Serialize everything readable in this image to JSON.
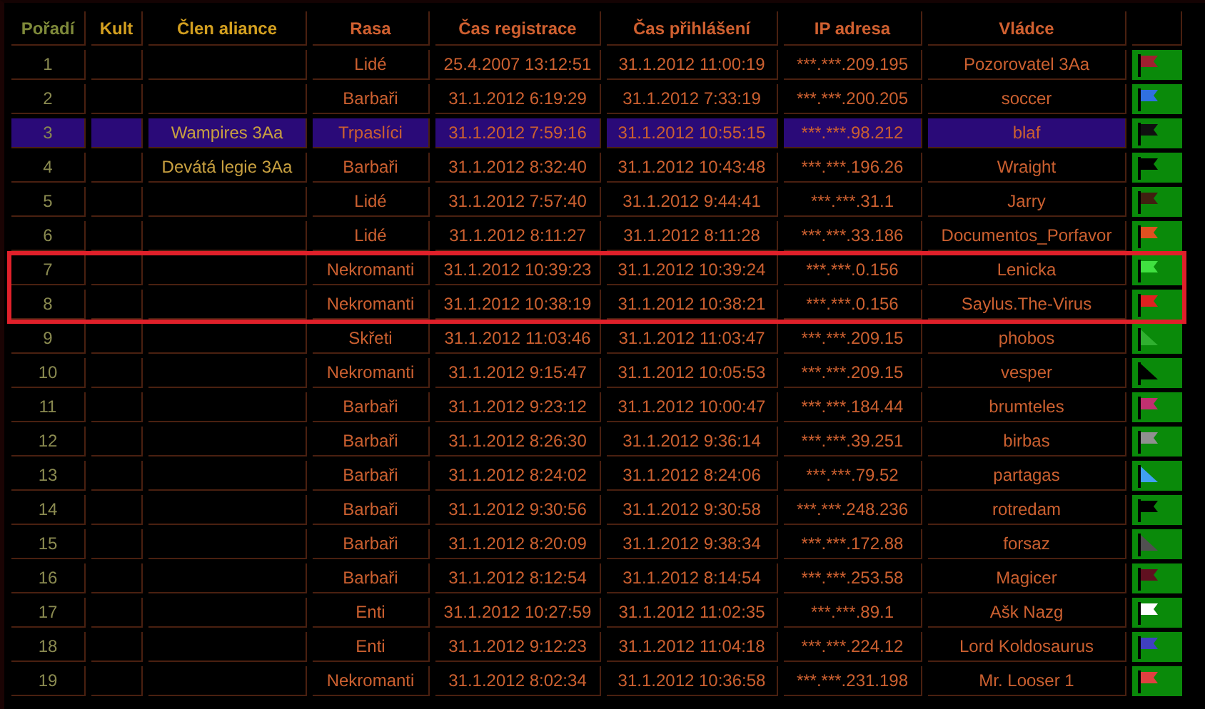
{
  "table": {
    "columns": [
      "Pořadí",
      "Kult",
      "Člen aliance",
      "Rasa",
      "Čas registrace",
      "Čas přihlášení",
      "IP adresa",
      "Vládce"
    ],
    "rows": [
      {
        "rank": "1",
        "alliance": "",
        "race": "Lidé",
        "registered": "25.4.2007 13:12:51",
        "login": "31.1.2012 11:00:19",
        "ip": "***.***.209.195",
        "ruler": "Pozorovatel 3Aa",
        "flag": {
          "kind": "banner",
          "color": "#a02030"
        },
        "selected": false,
        "marked": false
      },
      {
        "rank": "2",
        "alliance": "",
        "race": "Barbaři",
        "registered": "31.1.2012 6:19:29",
        "login": "31.1.2012 7:33:19",
        "ip": "***.***.200.205",
        "ruler": "soccer",
        "flag": {
          "kind": "banner",
          "color": "#3070e0"
        },
        "selected": false,
        "marked": false
      },
      {
        "rank": "3",
        "alliance": "Wampires 3Aa",
        "race": "Trpaslíci",
        "registered": "31.1.2012 7:59:16",
        "login": "31.1.2012 10:55:15",
        "ip": "***.***.98.212",
        "ruler": "blaf",
        "flag": {
          "kind": "banner",
          "color": "#101010"
        },
        "selected": true,
        "marked": false
      },
      {
        "rank": "4",
        "alliance": "Devátá legie 3Aa",
        "race": "Barbaři",
        "registered": "31.1.2012 8:32:40",
        "login": "31.1.2012 10:43:48",
        "ip": "***.***.196.26",
        "ruler": "Wraight",
        "flag": {
          "kind": "banner",
          "color": "#000000"
        },
        "selected": false,
        "marked": false
      },
      {
        "rank": "5",
        "alliance": "",
        "race": "Lidé",
        "registered": "31.1.2012 7:57:40",
        "login": "31.1.2012 9:44:41",
        "ip": "***.***.31.1",
        "ruler": "Jarry",
        "flag": {
          "kind": "banner",
          "color": "#402010"
        },
        "selected": false,
        "marked": false
      },
      {
        "rank": "6",
        "alliance": "",
        "race": "Lidé",
        "registered": "31.1.2012 8:11:27",
        "login": "31.1.2012 8:11:28",
        "ip": "***.***.33.186",
        "ruler": "Documentos_Porfavor",
        "flag": {
          "kind": "banner",
          "color": "#e05020"
        },
        "selected": false,
        "marked": false
      },
      {
        "rank": "7",
        "alliance": "",
        "race": "Nekromanti",
        "registered": "31.1.2012 10:39:23",
        "login": "31.1.2012 10:39:24",
        "ip": "***.***.0.156",
        "ruler": "Lenicka",
        "flag": {
          "kind": "banner",
          "color": "#40e040"
        },
        "selected": false,
        "marked": true
      },
      {
        "rank": "8",
        "alliance": "",
        "race": "Nekromanti",
        "registered": "31.1.2012 10:38:19",
        "login": "31.1.2012 10:38:21",
        "ip": "***.***.0.156",
        "ruler": "Saylus.The-Virus",
        "flag": {
          "kind": "banner",
          "color": "#e02020"
        },
        "selected": false,
        "marked": true
      },
      {
        "rank": "9",
        "alliance": "",
        "race": "Skřeti",
        "registered": "31.1.2012 11:03:46",
        "login": "31.1.2012 11:03:47",
        "ip": "***.***.209.15",
        "ruler": "phobos",
        "flag": {
          "kind": "pennant",
          "color": "#30b030"
        },
        "selected": false,
        "marked": false
      },
      {
        "rank": "10",
        "alliance": "",
        "race": "Nekromanti",
        "registered": "31.1.2012 9:15:47",
        "login": "31.1.2012 10:05:53",
        "ip": "***.***.209.15",
        "ruler": "vesper",
        "flag": {
          "kind": "pennant",
          "color": "#000000"
        },
        "selected": false,
        "marked": false
      },
      {
        "rank": "11",
        "alliance": "",
        "race": "Barbaři",
        "registered": "31.1.2012 9:23:12",
        "login": "31.1.2012 10:00:47",
        "ip": "***.***.184.44",
        "ruler": "brumteles",
        "flag": {
          "kind": "banner",
          "color": "#c03070"
        },
        "selected": false,
        "marked": false
      },
      {
        "rank": "12",
        "alliance": "",
        "race": "Barbaři",
        "registered": "31.1.2012 8:26:30",
        "login": "31.1.2012 9:36:14",
        "ip": "***.***.39.251",
        "ruler": "birbas",
        "flag": {
          "kind": "banner",
          "color": "#909090"
        },
        "selected": false,
        "marked": false
      },
      {
        "rank": "13",
        "alliance": "",
        "race": "Barbaři",
        "registered": "31.1.2012 8:24:02",
        "login": "31.1.2012 8:24:06",
        "ip": "***.***.79.52",
        "ruler": "partagas",
        "flag": {
          "kind": "pennant",
          "color": "#40a0f0"
        },
        "selected": false,
        "marked": false
      },
      {
        "rank": "14",
        "alliance": "",
        "race": "Barbaři",
        "registered": "31.1.2012 9:30:56",
        "login": "31.1.2012 9:30:58",
        "ip": "***.***.248.236",
        "ruler": "rotredam",
        "flag": {
          "kind": "banner",
          "color": "#000000"
        },
        "selected": false,
        "marked": false
      },
      {
        "rank": "15",
        "alliance": "",
        "race": "Barbaři",
        "registered": "31.1.2012 8:20:09",
        "login": "31.1.2012 9:38:34",
        "ip": "***.***.172.88",
        "ruler": "forsaz",
        "flag": {
          "kind": "pennant",
          "color": "#505050"
        },
        "selected": false,
        "marked": false
      },
      {
        "rank": "16",
        "alliance": "",
        "race": "Barbaři",
        "registered": "31.1.2012 8:12:54",
        "login": "31.1.2012 8:14:54",
        "ip": "***.***.253.58",
        "ruler": "Magicer",
        "flag": {
          "kind": "banner",
          "color": "#601020"
        },
        "selected": false,
        "marked": false
      },
      {
        "rank": "17",
        "alliance": "",
        "race": "Enti",
        "registered": "31.1.2012 10:27:59",
        "login": "31.1.2012 11:02:35",
        "ip": "***.***.89.1",
        "ruler": "Ašk Nazg",
        "flag": {
          "kind": "banner",
          "color": "#ffffff"
        },
        "selected": false,
        "marked": false
      },
      {
        "rank": "18",
        "alliance": "",
        "race": "Enti",
        "registered": "31.1.2012 9:12:23",
        "login": "31.1.2012 11:04:18",
        "ip": "***.***.224.12",
        "ruler": "Lord Koldosaurus",
        "flag": {
          "kind": "banner",
          "color": "#4040c0"
        },
        "selected": false,
        "marked": false
      },
      {
        "rank": "19",
        "alliance": "",
        "race": "Nekromanti",
        "registered": "31.1.2012 8:02:34",
        "login": "31.1.2012 10:36:58",
        "ip": "***.***.231.198",
        "ruler": "Mr. Looser 1",
        "flag": {
          "kind": "banner",
          "color": "#e04040"
        },
        "selected": false,
        "marked": false
      }
    ]
  }
}
